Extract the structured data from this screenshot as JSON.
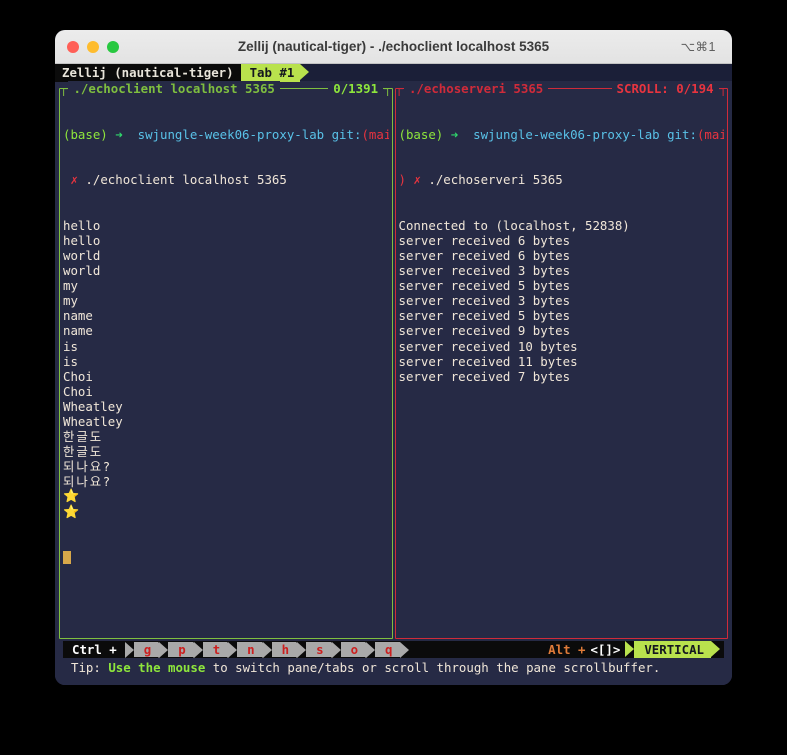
{
  "window": {
    "title": "Zellij (nautical-tiger) - ./echoclient localhost 5365",
    "shortcut": "⌥⌘1",
    "traffic_lights": [
      "close",
      "minimize",
      "maximize"
    ]
  },
  "tabbar": {
    "session_name": "Zellij (nautical-tiger)",
    "tabs": [
      {
        "label": "Tab #1",
        "active": true
      }
    ]
  },
  "panes": [
    {
      "id": "left",
      "title": "./echoclient localhost 5365",
      "status": "0/1391",
      "border_color": "#7fbf3f",
      "accent_color": "#8ee63c",
      "focused": true,
      "prompt": {
        "env": "(base)",
        "arrow": "➜",
        "dir": "swjungle-week06-proxy-lab",
        "git_prefix": "git:",
        "git_branch": "(main)",
        "status_mark": "✗",
        "command": "./echoclient localhost 5365"
      },
      "output": [
        "hello",
        "hello",
        "world",
        "world",
        "my",
        "my",
        "name",
        "name",
        "is",
        "is",
        "Choi",
        "Choi",
        "Wheatley",
        "Wheatley",
        "한글도",
        "한글도",
        "되나요?",
        "되나요?",
        "⭐",
        "⭐"
      ],
      "cursor": "block"
    },
    {
      "id": "right",
      "title": "./echoserveri 5365",
      "status": "SCROLL:  0/194",
      "border_color": "#d02b3a",
      "accent_color": "#e8343f",
      "focused": false,
      "prompt": {
        "env": "(base)",
        "arrow": "➜",
        "dir": "swjungle-week06-proxy-lab",
        "git_prefix": "git:",
        "git_branch_open": "(main",
        "git_branch_close": ")",
        "status_mark": "✗",
        "command": "./echoserveri 5365"
      },
      "output": [
        "Connected to (localhost, 52838)",
        "server received 6 bytes",
        "server received 6 bytes",
        "server received 3 bytes",
        "server received 5 bytes",
        "server received 3 bytes",
        "server received 5 bytes",
        "server received 9 bytes",
        "server received 10 bytes",
        "server received 11 bytes",
        "server received 7 bytes"
      ]
    }
  ],
  "statusbar": {
    "ctrl_label": "Ctrl +",
    "keys": [
      "g",
      "p",
      "t",
      "n",
      "h",
      "s",
      "o",
      "q"
    ],
    "alt_label": "Alt +",
    "alt_keys": "<[]>",
    "mode": "VERTICAL",
    "tip_prefix": "Tip: ",
    "tip_highlight": "Use the mouse",
    "tip_suffix": " to switch pane/tabs or scroll through the pane scrollbuffer."
  }
}
